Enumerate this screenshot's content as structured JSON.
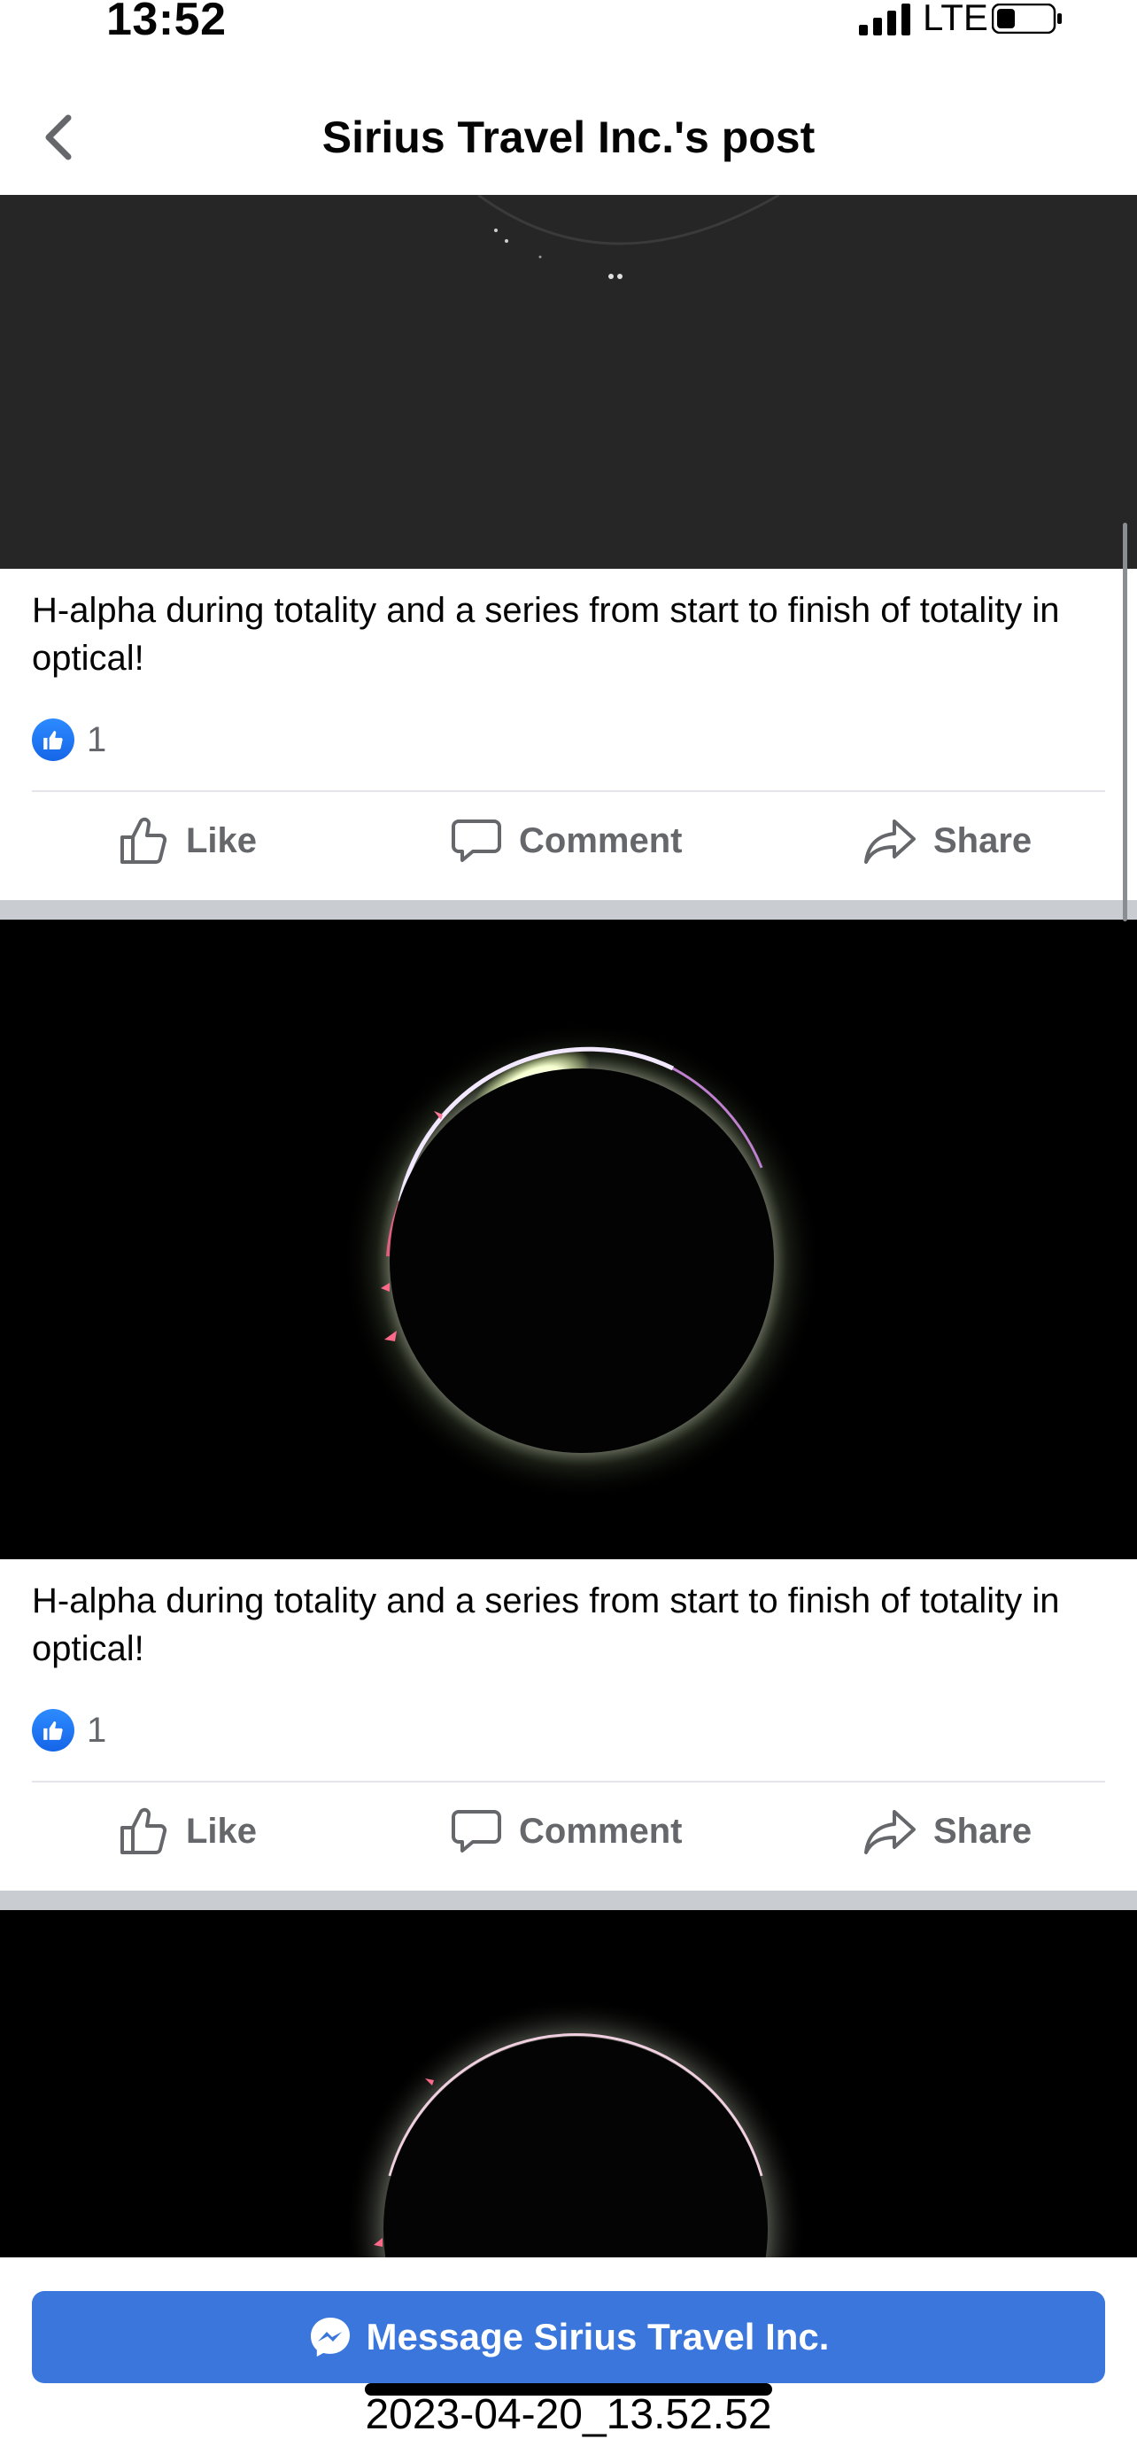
{
  "status_bar": {
    "time": "13:52",
    "network": "LTE"
  },
  "nav": {
    "title": "Sirius Travel Inc.'s post"
  },
  "posts": [
    {
      "caption": "H-alpha during totality and a series from start to finish of totality in optical!",
      "like_count": "1",
      "actions": {
        "like": "Like",
        "comment": "Comment",
        "share": "Share"
      }
    },
    {
      "caption": "H-alpha during totality and a series from start to finish of totality in optical!",
      "like_count": "1",
      "actions": {
        "like": "Like",
        "comment": "Comment",
        "share": "Share"
      }
    }
  ],
  "bottom_bar": {
    "message_button": "Message Sirius Travel Inc."
  },
  "overlay": {
    "timestamp": "2023-04-20_13.52.52"
  },
  "colors": {
    "brand_blue": "#3a76dc",
    "like_blue": "#1877f2",
    "text_secondary": "#65676b",
    "separator": "#c9ccd1"
  }
}
